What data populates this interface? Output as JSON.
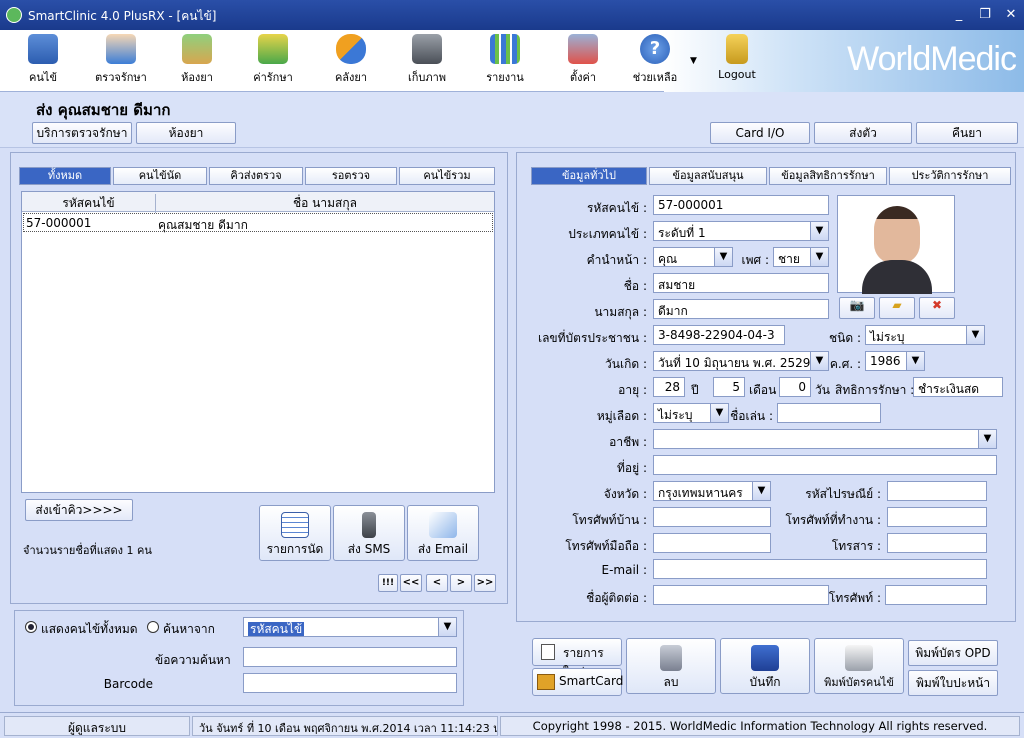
{
  "window": {
    "title": "SmartClinic 4.0 PlusRX - [คนไข้]"
  },
  "toolbar": {
    "items": [
      {
        "label": "คนไข้",
        "icon": "patient-book-icon"
      },
      {
        "label": "ตรวจรักษา",
        "icon": "doctor-icon"
      },
      {
        "label": "ห้องยา",
        "icon": "pharmacy-icon"
      },
      {
        "label": "ค่ารักษา",
        "icon": "money-icon"
      },
      {
        "label": "คลังยา",
        "icon": "pill-icon"
      },
      {
        "label": "เก็บภาพ",
        "icon": "camera-icon"
      },
      {
        "label": "รายงาน",
        "icon": "chart-icon"
      },
      {
        "label": "ตั้งค่า",
        "icon": "tools-icon"
      },
      {
        "label": "ช่วยเหลือ",
        "icon": "help-icon"
      },
      {
        "label": "Logout",
        "icon": "lock-icon"
      }
    ],
    "brand": "WorldMedic"
  },
  "header": {
    "patient_title": "ส่ง  คุณสมชาย ดีมาก",
    "left_buttons": [
      "บริการตรวจรักษา",
      "ห้องยา"
    ],
    "right_buttons": [
      "Card I/O",
      "ส่งตัว",
      "คืนยา"
    ]
  },
  "left": {
    "tabs": [
      "ทั้งหมด",
      "คนไข้นัด",
      "คิวส่งตรวจ",
      "รอตรวจ",
      "คนไข้รวม"
    ],
    "columns": [
      "รหัสคนไข้",
      "ชื่อ นามสกุล"
    ],
    "rows": [
      {
        "id": "57-000001",
        "name": "คุณสมชาย ดีมาก"
      }
    ],
    "queue_button": "ส่งเข้าคิว>>>>",
    "count_text": "จำนวนรายชื่อที่แสดง 1 คน",
    "actions": [
      "รายการนัด",
      "ส่ง SMS",
      "ส่ง Email"
    ],
    "pager": [
      "!!!",
      "<<",
      "<",
      ">",
      ">>"
    ],
    "search": {
      "radio_all": "แสดงคนไข้ทั้งหมด",
      "radio_search": "ค้นหาจาก",
      "search_by": "รหัสคนไข้",
      "keyword_label": "ข้อความค้นหา",
      "barcode_label": "Barcode",
      "keyword_value": "",
      "barcode_value": ""
    }
  },
  "right": {
    "tabs": [
      "ข้อมูลทั่วไป",
      "ข้อมูลสนับสนุน",
      "ข้อมูลสิทธิการรักษา",
      "ประวัติการรักษา"
    ],
    "labels": {
      "hn": "รหัสคนไข้ :",
      "type": "ประเภทคนไข้ :",
      "prefix": "คำนำหน้า :",
      "sex": "เพศ :",
      "fname": "ชื่อ :",
      "lname": "นามสกุล :",
      "idcard": "เลขที่บัตรประชาชน :",
      "idtype": "ชนิด :",
      "dob": "วันเกิด :",
      "ce": "ค.ศ. :",
      "age": "อายุ :",
      "years": "ปี",
      "months": "เดือน",
      "days": "วัน",
      "right": "สิทธิการรักษา :",
      "blood": "หมู่เลือด :",
      "nick": "ชื่อเล่น :",
      "job": "อาชีพ :",
      "addr": "ที่อยู่ :",
      "prov": "จังหวัด :",
      "zip": "รหัสไปรษณีย์ :",
      "homephone": "โทรศัพท์บ้าน :",
      "workphone": "โทรศัพท์ที่ทำงาน :",
      "mobile": "โทรศัพท์มือถือ :",
      "fax": "โทรสาร :",
      "email": "E-mail :",
      "contact": "ชื่อผู้ติดต่อ :",
      "phone": "โทรศัพท์ :"
    },
    "values": {
      "hn": "57-000001",
      "type": "ระดับที่ 1",
      "prefix": "คุณ",
      "sex": "ชาย",
      "fname": "สมชาย",
      "lname": "ดีมาก",
      "idcard": "3-8498-22904-04-3",
      "idtype": "ไม่ระบุ",
      "dob": "วันที่ 10  มิถุนายน  พ.ศ.  2529",
      "ce": "1986",
      "age_y": "28",
      "age_m": "5",
      "age_d": "0",
      "right": "ชำระเงินสด",
      "blood": "ไม่ระบุ",
      "nick": "",
      "job": "",
      "addr": "",
      "prov": "กรุงเทพมหานคร",
      "zip": "",
      "homephone": "",
      "workphone": "",
      "mobile": "",
      "fax": "",
      "email": "",
      "contact": "",
      "phone": ""
    },
    "bottom_buttons": {
      "new_item": "รายการใหม่",
      "smartcard": "SmartCard",
      "delete": "ลบ",
      "save": "บันทึก",
      "print_card": "พิมพ์บัตรคนไข้",
      "print_opd": "พิมพ์บัตร OPD",
      "print_cover": "พิมพ์ใบปะหน้า"
    }
  },
  "status": {
    "user": "ผู้ดูแลระบบ",
    "datetime": "วัน จันทร์ ที่ 10 เดือน พฤศจิกายน พ.ศ.2014 เวลา 11:14:23 น.",
    "copyright": "Copyright 1998 - 2015. WorldMedic Information Technology All rights reserved."
  },
  "colors": {
    "accent": "#3a66c4",
    "title_bar": "#1a3a8c",
    "panel": "#d6dff7"
  }
}
